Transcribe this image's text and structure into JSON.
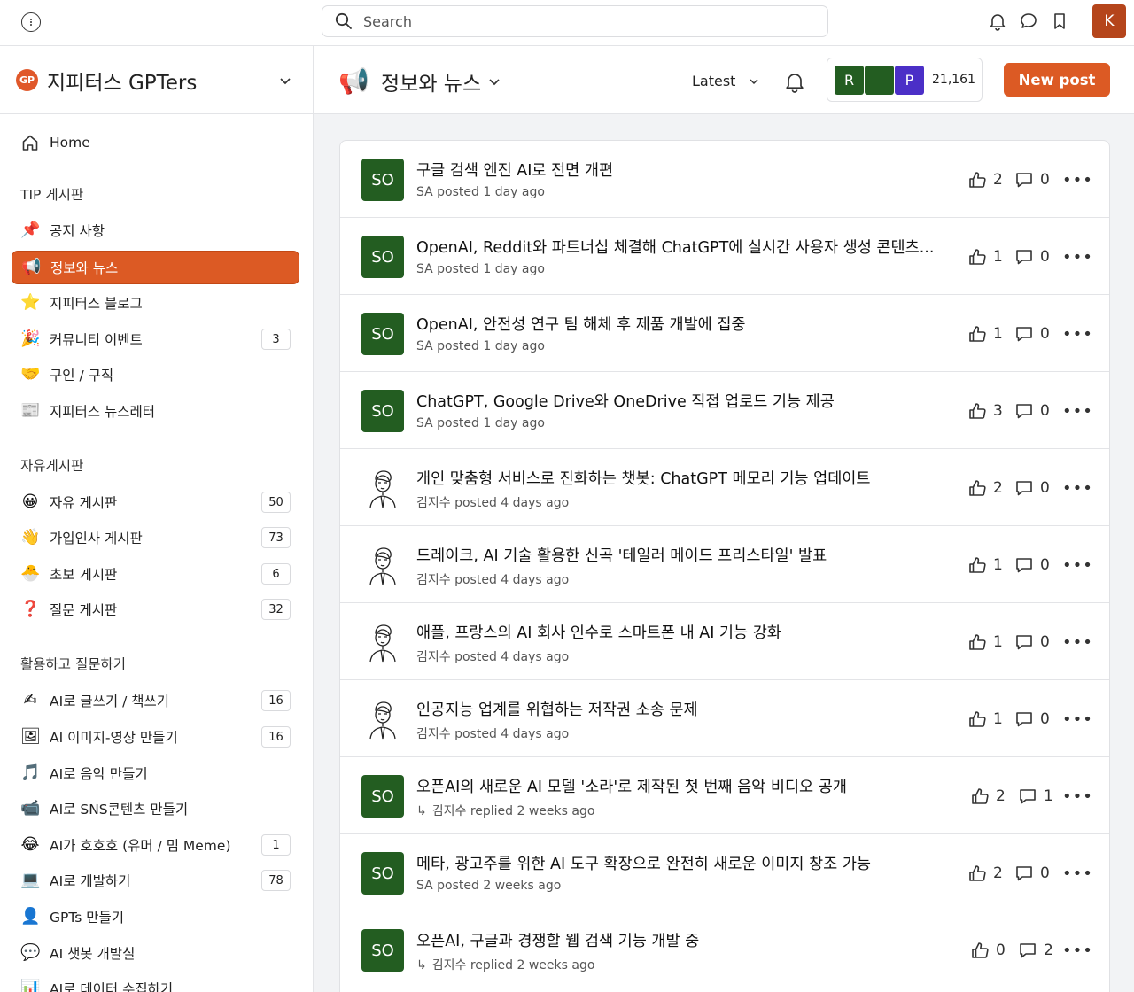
{
  "search": {
    "placeholder": "Search"
  },
  "user": {
    "initial": "K"
  },
  "sidebar": {
    "brand": "지피터스 GPTers",
    "brand_logo_text": "GP",
    "home": "Home",
    "sections": [
      {
        "title": "TIP 게시판"
      },
      {
        "title": "자유게시판"
      },
      {
        "title": "활용하고 질문하기"
      }
    ],
    "items": [
      {
        "label": "공지 사항",
        "icon": "📌"
      },
      {
        "label": "정보와 뉴스",
        "icon": "📢"
      },
      {
        "label": "지피터스 블로그",
        "icon": "⭐"
      },
      {
        "label": "커뮤니티 이벤트",
        "icon": "🎉",
        "badge": "3"
      },
      {
        "label": "구인 / 구직",
        "icon": "🤝"
      },
      {
        "label": "지피터스 뉴스레터",
        "icon": "📰"
      },
      {
        "label": "자유 게시판",
        "icon": "😀",
        "badge": "50"
      },
      {
        "label": "가입인사 게시판",
        "icon": "👋",
        "badge": "73"
      },
      {
        "label": "초보 게시판",
        "icon": "🐣",
        "badge": "6"
      },
      {
        "label": "질문 게시판",
        "icon": "❓",
        "badge": "32"
      },
      {
        "label": "AI로 글쓰기 / 책쓰기",
        "icon": "✍",
        "badge": "16"
      },
      {
        "label": "AI 이미지-영상 만들기",
        "icon": "🖼",
        "badge": "16"
      },
      {
        "label": "AI로 음악 만들기",
        "icon": "🎵"
      },
      {
        "label": "AI로 SNS콘텐츠 만들기",
        "icon": "📹"
      },
      {
        "label": "AI가 호호호 (유머 / 밈 Meme)",
        "icon": "😂",
        "badge": "1"
      },
      {
        "label": "AI로 개발하기",
        "icon": "💻",
        "badge": "78"
      },
      {
        "label": "GPTs 만들기",
        "icon": "👤"
      },
      {
        "label": "AI 챗봇 개발실",
        "icon": "💬"
      },
      {
        "label": "AI로 데이터 수집하기",
        "icon": "📊"
      }
    ]
  },
  "header": {
    "icon": "📢",
    "title": "정보와 뉴스",
    "sort": "Latest",
    "members": [
      "R",
      "",
      "P"
    ],
    "member_count": "21,161",
    "new_post": "New post"
  },
  "posts": [
    {
      "avatar": "SO",
      "title": "구글 검색 엔진 AI로 전면 개편",
      "author": "SA",
      "action": "posted",
      "time": "1 day ago",
      "likes": "2",
      "comments": "0"
    },
    {
      "avatar": "SO",
      "title": "OpenAI, Reddit와 파트너십 체결해 ChatGPT에 실시간 사용자 생성 콘텐츠...",
      "author": "SA",
      "action": "posted",
      "time": "1 day ago",
      "likes": "1",
      "comments": "0"
    },
    {
      "avatar": "SO",
      "title": "OpenAI, 안전성 연구 팀 해체 후 제품 개발에 집중",
      "author": "SA",
      "action": "posted",
      "time": "1 day ago",
      "likes": "1",
      "comments": "0"
    },
    {
      "avatar": "SO",
      "title": "ChatGPT, Google Drive와 OneDrive 직접 업로드 기능 제공",
      "author": "SA",
      "action": "posted",
      "time": "1 day ago",
      "likes": "3",
      "comments": "0"
    },
    {
      "avatar": "",
      "title": "개인 맞춤형 서비스로 진화하는 챗봇: ChatGPT 메모리 기능 업데이트",
      "author": "김지수",
      "action": "posted",
      "time": "4 days ago",
      "likes": "2",
      "comments": "0"
    },
    {
      "avatar": "",
      "title": "드레이크, AI 기술 활용한 신곡 '테일러 메이드 프리스타일' 발표",
      "author": "김지수",
      "action": "posted",
      "time": "4 days ago",
      "likes": "1",
      "comments": "0"
    },
    {
      "avatar": "",
      "title": "애플, 프랑스의 AI 회사 인수로 스마트폰 내 AI 기능 강화",
      "author": "김지수",
      "action": "posted",
      "time": "4 days ago",
      "likes": "1",
      "comments": "0"
    },
    {
      "avatar": "",
      "title": "인공지능 업계를 위협하는 저작권 소송 문제",
      "author": "김지수",
      "action": "posted",
      "time": "4 days ago",
      "likes": "1",
      "comments": "0"
    },
    {
      "avatar": "SO",
      "title": "오픈AI의 새로운 AI 모델 '소라'로 제작된 첫 번째 음악 비디오 공개",
      "author": "김지수",
      "action": "replied",
      "time": "2 weeks ago",
      "likes": "2",
      "comments": "1"
    },
    {
      "avatar": "SO",
      "title": "메타, 광고주를 위한 AI 도구 확장으로 완전히 새로운 이미지 창조 가능",
      "author": "SA",
      "action": "posted",
      "time": "2 weeks ago",
      "likes": "2",
      "comments": "0"
    },
    {
      "avatar": "SO",
      "title": "오픈AI, 구글과 경쟁할 웹 검색 기능 개발 중",
      "author": "김지수",
      "action": "replied",
      "time": "2 weeks ago",
      "likes": "0",
      "comments": "2"
    }
  ],
  "colors": {
    "accent": "#dc5a24",
    "avatar_green": "#235d21",
    "member_purple": "#4b2fc7"
  }
}
